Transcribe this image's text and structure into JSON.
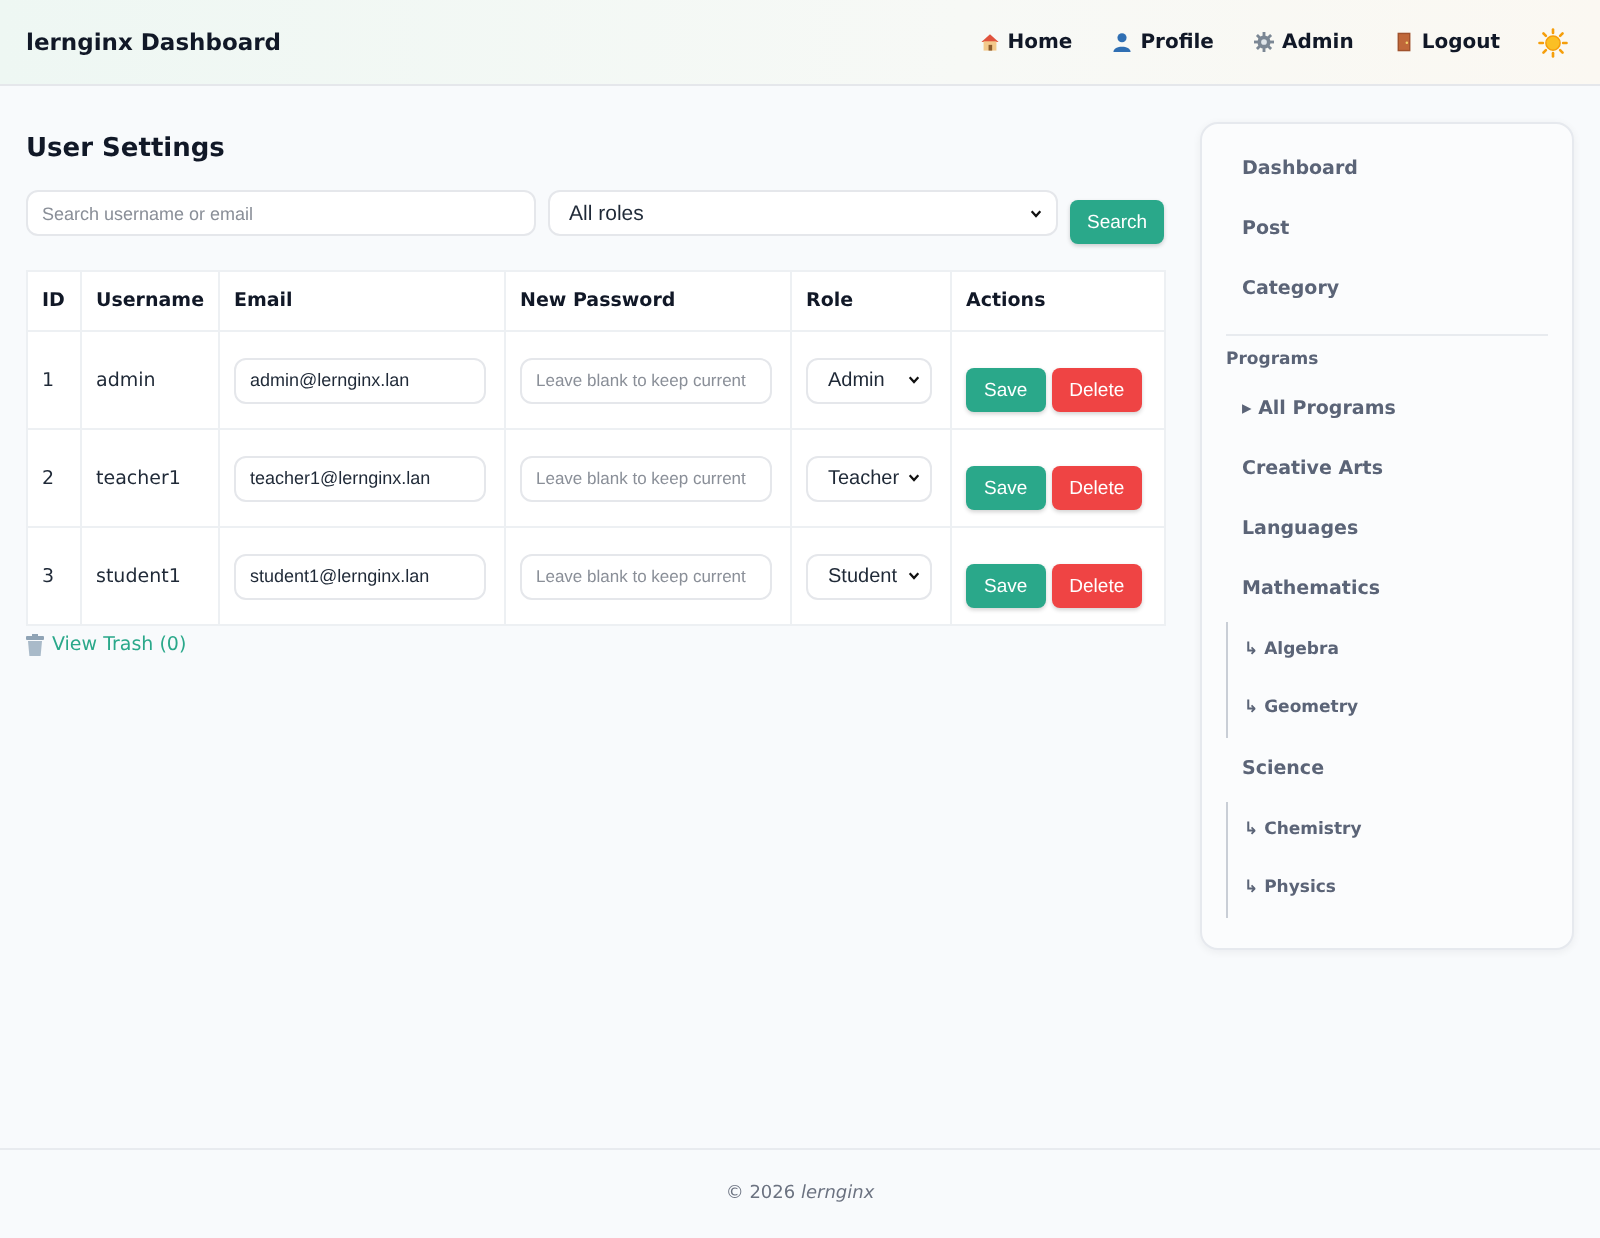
{
  "header": {
    "title": "lernginx Dashboard",
    "nav": [
      {
        "label": "Home"
      },
      {
        "label": "Profile"
      },
      {
        "label": "Admin"
      },
      {
        "label": "Logout"
      }
    ]
  },
  "page": {
    "title": "User Settings",
    "search": {
      "placeholder": "Search username or email"
    },
    "role_filter": {
      "value": "All roles"
    },
    "search_button": "Search"
  },
  "table": {
    "columns": [
      "ID",
      "Username",
      "Email",
      "New Password",
      "Role",
      "Actions"
    ],
    "rows": [
      {
        "id": "1",
        "username": "admin",
        "email": "admin@lernginx.lan",
        "password_placeholder": "Leave blank to keep current",
        "role": "Admin",
        "actions": [
          {
            "label": "Save",
            "kind": "primary"
          },
          {
            "label": "Delete",
            "kind": "danger"
          }
        ]
      },
      {
        "id": "2",
        "username": "teacher1",
        "email": "teacher1@lernginx.lan",
        "password_placeholder": "Leave blank to keep current",
        "role": "Teacher",
        "actions": [
          {
            "label": "Save",
            "kind": "primary"
          },
          {
            "label": "Delete",
            "kind": "danger"
          }
        ]
      },
      {
        "id": "3",
        "username": "student1",
        "email": "student1@lernginx.lan",
        "password_placeholder": "Leave blank to keep current",
        "role": "Student",
        "actions": [
          {
            "label": "Save",
            "kind": "primary"
          },
          {
            "label": "Delete",
            "kind": "danger"
          }
        ]
      }
    ]
  },
  "trash_link": "View Trash (0)",
  "sidebar": {
    "items": [
      {
        "label": "Dashboard"
      },
      {
        "label": "Post"
      },
      {
        "label": "Category"
      }
    ],
    "section_title": "Programs",
    "programs": [
      {
        "label": "▸ All Programs"
      },
      {
        "label": "Creative Arts"
      },
      {
        "label": "Languages"
      },
      {
        "label": "Mathematics",
        "children": [
          {
            "label": "↳ Algebra"
          },
          {
            "label": "↳ Geometry"
          }
        ]
      },
      {
        "label": "Science",
        "children": [
          {
            "label": "↳ Chemistry"
          },
          {
            "label": "↳ Physics"
          }
        ]
      }
    ]
  },
  "footer": "© 2026 *lernginx*"
}
